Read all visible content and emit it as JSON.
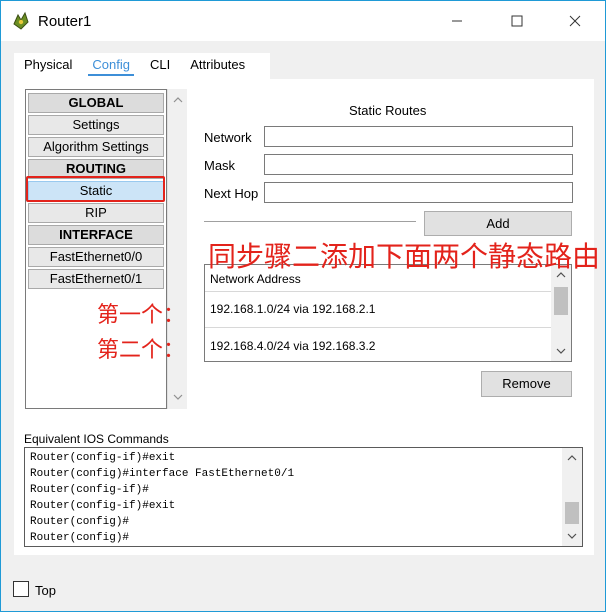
{
  "window": {
    "title": "Router1"
  },
  "tabs": [
    {
      "label": "Physical"
    },
    {
      "label": "Config"
    },
    {
      "label": "CLI"
    },
    {
      "label": "Attributes"
    }
  ],
  "nav": {
    "global_header": "GLOBAL",
    "settings": "Settings",
    "algorithm_settings": "Algorithm Settings",
    "routing_header": "ROUTING",
    "static": "Static",
    "rip": "RIP",
    "interface_header": "INTERFACE",
    "fe00": "FastEthernet0/0",
    "fe01": "FastEthernet0/1"
  },
  "static_routes": {
    "title": "Static Routes",
    "network_label": "Network",
    "mask_label": "Mask",
    "next_hop_label": "Next Hop",
    "network_value": "",
    "mask_value": "",
    "next_hop_value": "",
    "add_label": "Add",
    "list_header": "Network Address",
    "routes": [
      "192.168.1.0/24 via 192.168.2.1",
      "192.168.4.0/24 via 192.168.3.2"
    ],
    "remove_label": "Remove"
  },
  "ios": {
    "label": "Equivalent IOS Commands",
    "lines": [
      "Router(config-if)#exit",
      "Router(config)#interface FastEthernet0/1",
      "Router(config-if)#",
      "Router(config-if)#exit",
      "Router(config)#",
      "Router(config)#"
    ]
  },
  "top_checkbox_label": "Top",
  "annotations": {
    "main": "同步骤二添加下面两个静态路由",
    "first": "第一个：",
    "second": "第二个："
  },
  "colors": {
    "accent": "#3d8fd8",
    "annotation": "#e3231b",
    "window_border": "#1f9ad6"
  }
}
